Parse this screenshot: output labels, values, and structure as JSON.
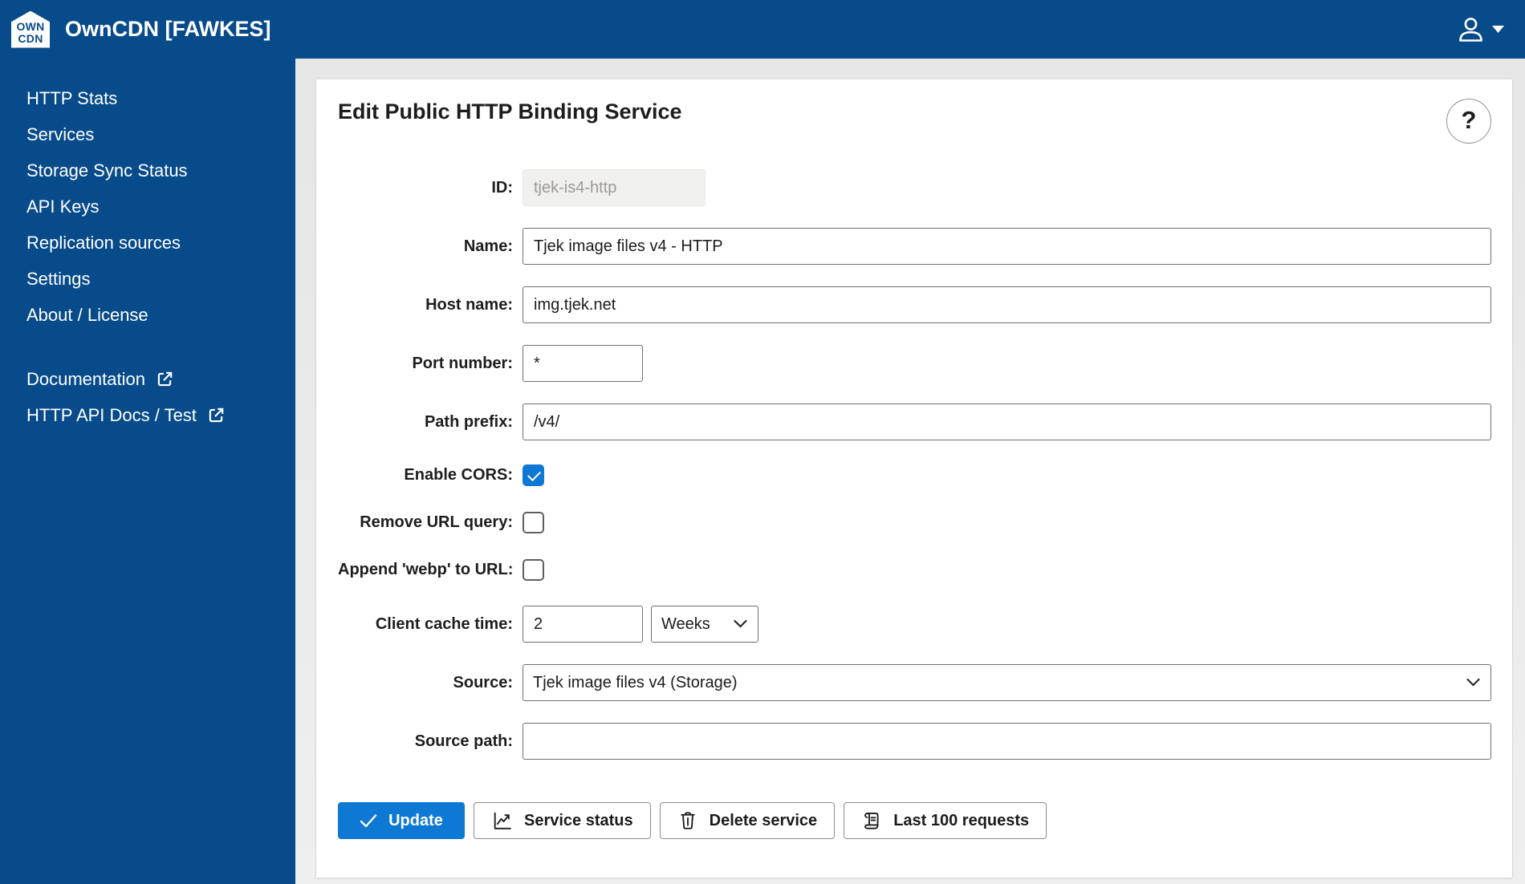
{
  "header": {
    "logo_line1": "OWN",
    "logo_line2": "CDN",
    "title": "OwnCDN [FAWKES]"
  },
  "sidebar": {
    "items": [
      {
        "label": "HTTP Stats"
      },
      {
        "label": "Services"
      },
      {
        "label": "Storage Sync Status"
      },
      {
        "label": "API Keys"
      },
      {
        "label": "Replication sources"
      },
      {
        "label": "Settings"
      },
      {
        "label": "About / License"
      }
    ],
    "external_links": [
      {
        "label": "Documentation"
      },
      {
        "label": "HTTP API Docs / Test"
      }
    ]
  },
  "main": {
    "heading": "Edit Public HTTP Binding Service",
    "help_label": "?",
    "form": {
      "id": {
        "label": "ID:",
        "value": "tjek-is4-http"
      },
      "name": {
        "label": "Name:",
        "value": "Tjek image files v4 - HTTP"
      },
      "host": {
        "label": "Host name:",
        "value": "img.tjek.net"
      },
      "port": {
        "label": "Port number:",
        "value": "*"
      },
      "path_prefix": {
        "label": "Path prefix:",
        "value": "/v4/"
      },
      "enable_cors": {
        "label": "Enable CORS:",
        "checked": true
      },
      "remove_url_query": {
        "label": "Remove URL query:",
        "checked": false
      },
      "append_webp": {
        "label": "Append 'webp' to URL:",
        "checked": false
      },
      "client_cache_time": {
        "label": "Client cache time:",
        "value": "2",
        "unit": "Weeks"
      },
      "source": {
        "label": "Source:",
        "value": "Tjek image files v4 (Storage)"
      },
      "source_path": {
        "label": "Source path:",
        "value": ""
      }
    },
    "buttons": {
      "update": "Update",
      "service_status": "Service status",
      "delete_service": "Delete service",
      "last_requests": "Last 100 requests"
    }
  },
  "colors": {
    "brand_blue": "#084b8a",
    "accent_blue": "#0e78d5",
    "page_bg": "#ebebeb"
  }
}
